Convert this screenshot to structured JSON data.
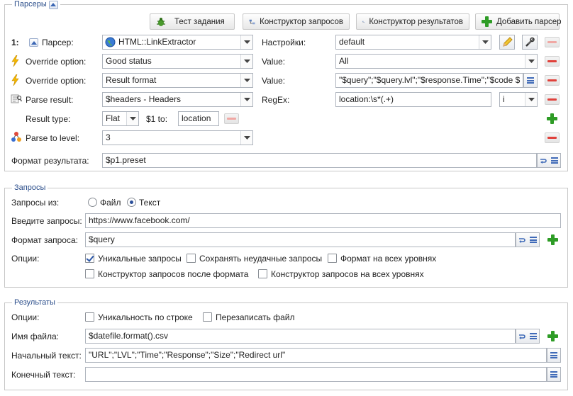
{
  "parsers": {
    "legend": "Парсеры",
    "toolbar": {
      "test_task": "Тест задания",
      "query_builder": "Конструктор запросов",
      "result_builder": "Конструктор результатов",
      "add_parser": "Добавить парсер"
    },
    "row_parser": {
      "index": "1:",
      "label": "Парсер:",
      "value": "HTML::LinkExtractor",
      "settings_label": "Настройки:",
      "settings_value": "default"
    },
    "row_override1": {
      "label": "Override option:",
      "value": "Good status",
      "value_label": "Value:",
      "value_value": "All"
    },
    "row_override2": {
      "label": "Override option:",
      "value": "Result format",
      "value_label": "Value:",
      "value_value": "\"$query\";\"$query.lvl\";\"$response.Time\";\"$code $"
    },
    "row_parse_result": {
      "label": "Parse result:",
      "value": "$headers - Headers",
      "regex_label": "RegEx:",
      "regex_value": "location:\\s*(.+)",
      "flags_value": "i"
    },
    "row_result_type": {
      "label": "Result type:",
      "value": "Flat",
      "to_label": "$1 to:",
      "to_value": "location"
    },
    "row_level": {
      "label": "Parse to level:",
      "value": "3"
    },
    "result_format": {
      "label": "Формат результата:",
      "value": "$p1.preset"
    }
  },
  "queries": {
    "legend": "Запросы",
    "from_label": "Запросы из:",
    "from_options": [
      "Файл",
      "Текст"
    ],
    "from_selected": "Текст",
    "enter_label": "Введите запросы:",
    "enter_value": "https://www.facebook.com/",
    "format_label": "Формат запроса:",
    "format_value": "$query",
    "options_label": "Опции:",
    "options": [
      {
        "label": "Уникальные запросы",
        "checked": true
      },
      {
        "label": "Сохранять неудачные запросы",
        "checked": false
      },
      {
        "label": "Формат на всех уровнях",
        "checked": false
      },
      {
        "label": "Конструктор запросов после формата",
        "checked": false
      },
      {
        "label": "Конструктор запросов на всех уровнях",
        "checked": false
      }
    ]
  },
  "results": {
    "legend": "Результаты",
    "options_label": "Опции:",
    "options": [
      {
        "label": "Уникальность по строке",
        "checked": false
      },
      {
        "label": "Перезаписать файл",
        "checked": false
      }
    ],
    "filename_label": "Имя файла:",
    "filename_value": "$datefile.format().csv",
    "start_text_label": "Начальный текст:",
    "start_text_value": "\"URL\";\"LVL\";\"Time\";\"Response\";\"Size\";\"Redirect url\"",
    "end_text_label": "Конечный текст:",
    "end_text_value": ""
  },
  "colors": {
    "legend_text": "#2a4d8a",
    "remove_icon": "#e0413b",
    "add_icon": "#2e9c26",
    "border": "#c6c6c6"
  },
  "icons": [
    "collapse-icon",
    "bug-icon",
    "builder-icon",
    "plus-icon",
    "minus-icon",
    "globe-icon",
    "lightning-icon",
    "parse-result-icon",
    "level-tree-icon",
    "pencil-icon",
    "tools-icon",
    "lines-icon",
    "format-wrap-icon",
    "chevron-down-icon"
  ]
}
